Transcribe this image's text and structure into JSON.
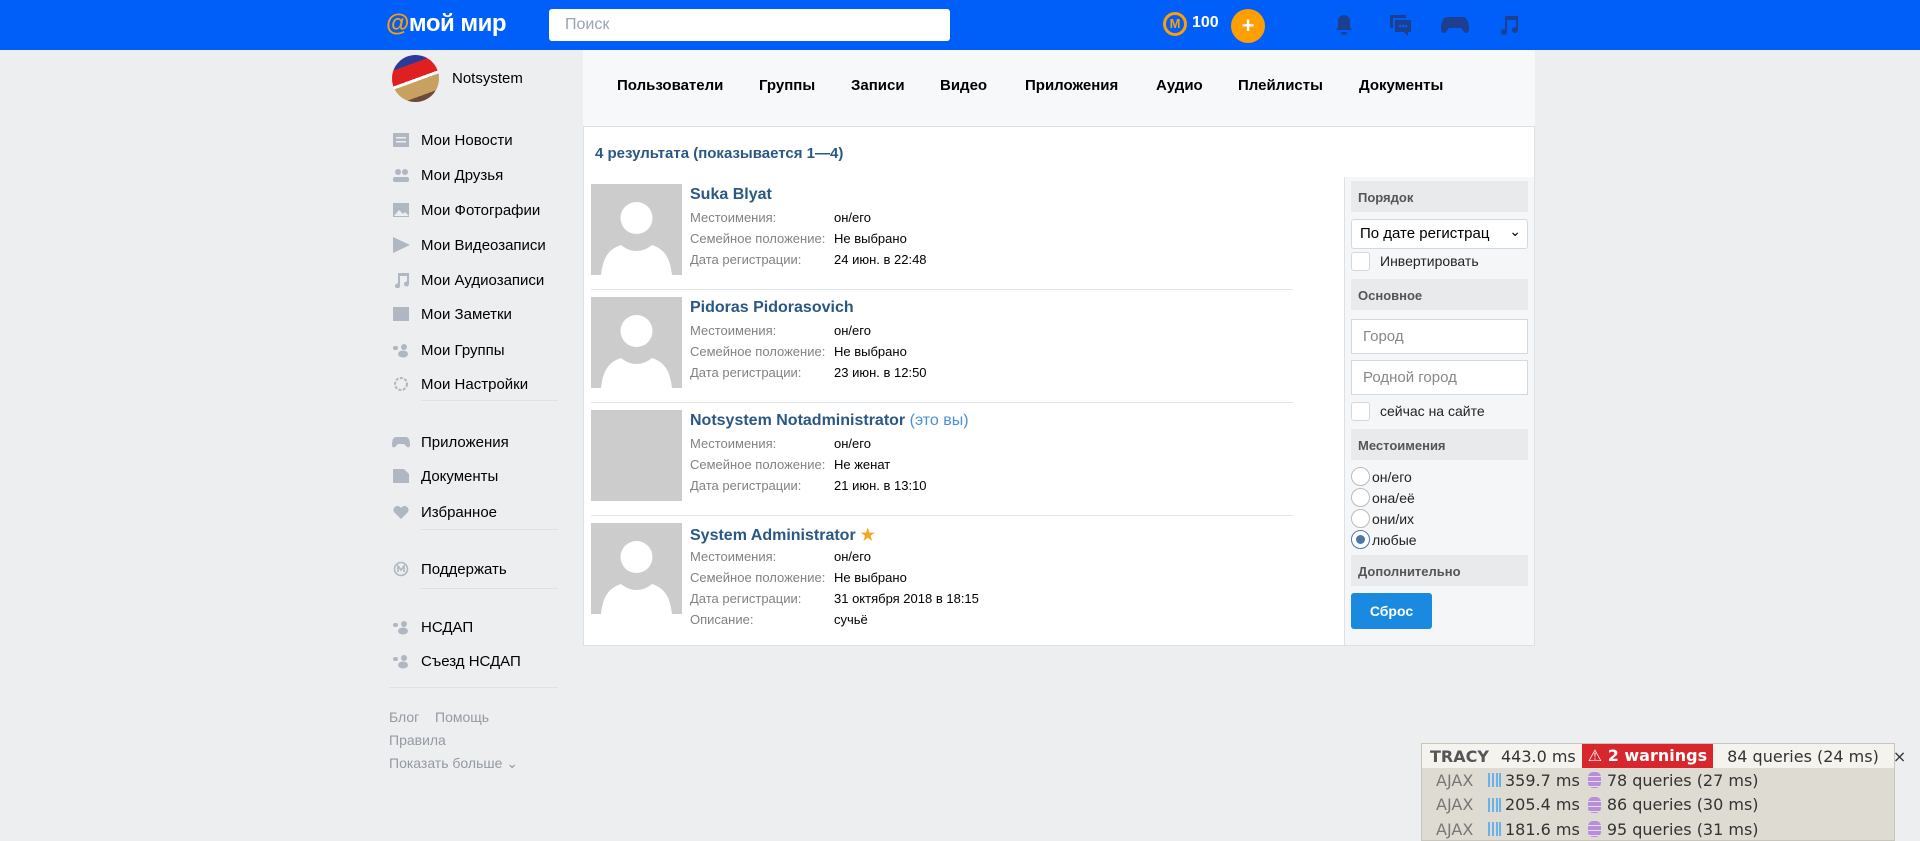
{
  "header": {
    "logo_at": "@",
    "logo_text": "мой мир",
    "search_placeholder": "Поиск",
    "coin_symbol": "M",
    "coins": "100",
    "plus": "+"
  },
  "sidebar": {
    "username": "Notsystem",
    "items": [
      {
        "label": "Мои Новости",
        "icon": "news-icon"
      },
      {
        "label": "Мои Друзья",
        "icon": "friends-icon"
      },
      {
        "label": "Мои Фотографии",
        "icon": "photos-icon"
      },
      {
        "label": "Мои Видеозаписи",
        "icon": "video-icon"
      },
      {
        "label": "Мои Аудиозаписи",
        "icon": "audio-icon"
      },
      {
        "label": "Мои Заметки",
        "icon": "notes-icon"
      },
      {
        "label": "Мои Группы",
        "icon": "groups-icon"
      },
      {
        "label": "Мои Настройки",
        "icon": "settings-icon"
      },
      {
        "label": "Приложения",
        "icon": "gamepad-icon"
      },
      {
        "label": "Документы",
        "icon": "documents-icon"
      },
      {
        "label": "Избранное",
        "icon": "heart-icon"
      },
      {
        "label": "Поддержать",
        "icon": "donate-icon"
      },
      {
        "label": "НСДАП",
        "icon": "groups-icon"
      },
      {
        "label": "Съезд НСДАП",
        "icon": "groups-icon"
      }
    ],
    "footer": {
      "blog": "Блог",
      "help": "Помощь",
      "rules": "Правила",
      "more": "Показать больше ⌄"
    }
  },
  "tabs": [
    "Пользователи",
    "Группы",
    "Записи",
    "Видео",
    "Приложения",
    "Аудио",
    "Плейлисты",
    "Документы"
  ],
  "results_title": "4 результата (показывается 1—4)",
  "results": [
    {
      "name": "Suka Blyat",
      "suffix": "",
      "star": false,
      "photo": false,
      "fields": [
        [
          "Местоимения:",
          "он/его"
        ],
        [
          "Семейное положение:",
          "Не выбрано"
        ],
        [
          "Дата регистрации:",
          "24 июн. в 22:48"
        ]
      ]
    },
    {
      "name": "Pidoras Pidorasovich",
      "suffix": "",
      "star": false,
      "photo": false,
      "fields": [
        [
          "Местоимения:",
          "он/его"
        ],
        [
          "Семейное положение:",
          "Не выбрано"
        ],
        [
          "Дата регистрации:",
          "23 июн. в 12:50"
        ]
      ]
    },
    {
      "name": "Notsystem Notadministrator",
      "suffix": "(это вы)",
      "star": false,
      "photo": true,
      "fields": [
        [
          "Местоимения:",
          "он/его"
        ],
        [
          "Семейное положение:",
          "Не женат"
        ],
        [
          "Дата регистрации:",
          "21 июн. в 13:10"
        ]
      ]
    },
    {
      "name": "System Administrator",
      "suffix": "",
      "star": true,
      "photo": false,
      "fields": [
        [
          "Местоимения:",
          "он/его"
        ],
        [
          "Семейное положение:",
          "Не выбрано"
        ],
        [
          "Дата регистрации:",
          "31 октября 2018 в 18:15"
        ],
        [
          "Описание:",
          "сучьё"
        ]
      ]
    }
  ],
  "filters": {
    "order_title": "Порядок",
    "order_value": "По дате регистрац",
    "invert": "Инвертировать",
    "basic_title": "Основное",
    "city_placeholder": "Город",
    "hometown_placeholder": "Родной город",
    "online": "сейчас на сайте",
    "pronouns_title": "Местоимения",
    "pronouns": [
      "он/его",
      "она/её",
      "они/их",
      "любые"
    ],
    "pronouns_selected": 3,
    "extra_title": "Дополнительно",
    "reset": "Сброс"
  },
  "tracy": {
    "label": "TRACY",
    "time": "443.0 ms",
    "warnings": "2 warnings",
    "queries": "84 queries (24 ms)",
    "close": "×",
    "ajax": [
      {
        "label": "AJAX",
        "time": "359.7 ms",
        "queries": "78 queries (27 ms)"
      },
      {
        "label": "AJAX",
        "time": "205.4 ms",
        "queries": "86 queries (30 ms)"
      },
      {
        "label": "AJAX",
        "time": "181.6 ms",
        "queries": "95 queries (31 ms)"
      }
    ]
  }
}
